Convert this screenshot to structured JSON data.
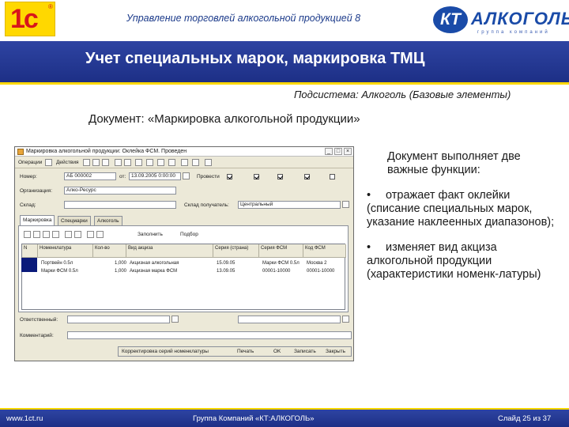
{
  "header": {
    "title": "Управление торговлей алкогольной продукцией 8",
    "logo_1c": "1с",
    "logo_kt": "КТ",
    "logo_alkogol": "АЛКОГОЛЬ",
    "logo_sub": "группа компаний"
  },
  "band": {
    "title": "Учет специальных марок, маркировка ТМЦ"
  },
  "subsystem": "Подсистема: Алкоголь (Базовые элементы)",
  "document_title": "Документ: «Маркировка алкогольной продукции»",
  "right_panel": {
    "intro": "Документ выполняет две важные функции:",
    "bullets": [
      "отражает факт оклейки (списание специальных марок, указание наклеенных диапазонов);",
      "изменяет вид акциза алкогольной продукции (характеристики номенк-латуры)"
    ]
  },
  "footer": {
    "site": "www.1ct.ru",
    "company": "Группа Компаний «КТ:АЛКОГОЛЬ»",
    "slide": "Слайд 25 из 37"
  },
  "window": {
    "title": "Маркировка алкогольной продукции: Оклейка ФСМ. Проведен",
    "toolbar": {
      "operation": "Операции",
      "actions": "Действия"
    },
    "fields": {
      "number_label": "Номер:",
      "number_value": "АБ 000002",
      "from_label": "от:",
      "date_value": "13.09.2005 0:00:00",
      "processed_label": "Провести",
      "org_label": "Организация:",
      "org_value": "Алко-Ресурс",
      "warehouse_label": "Склад:",
      "warehouse_value": "",
      "recipient_label": "Склад получатель:",
      "recipient_value": "Центральный"
    },
    "tabs": [
      "Маркировка",
      "Спецмарки",
      "Алкоголь"
    ],
    "grid_toolbar": {
      "fill": "Заполнить",
      "select": "Подбор"
    },
    "columns": [
      "Номенклатура",
      "Кол-во",
      "Вид акциза",
      "Серия (страна)",
      "Серия ФСМ",
      "Код ФСМ"
    ],
    "rows": [
      [
        "Портвейн 0.5л",
        "1,000",
        "Акцизная алкогольная",
        "15.09.05",
        "Марки ФСМ 0.5л",
        "Москва 2"
      ],
      [
        "Марки ФСМ 0.5л",
        "1,000",
        "Акцизная марка ФСМ",
        "13.09.05",
        "00001-10000",
        "00001-10000"
      ]
    ],
    "footer": {
      "responsible_label": "Ответственный:",
      "responsible_value": "",
      "comment_label": "Комментарий:",
      "comment_value": "",
      "status": "Корректировка серий номенклатуры",
      "print": "Печать",
      "ok": "OK",
      "write": "Записать",
      "close": "Закрыть"
    }
  }
}
